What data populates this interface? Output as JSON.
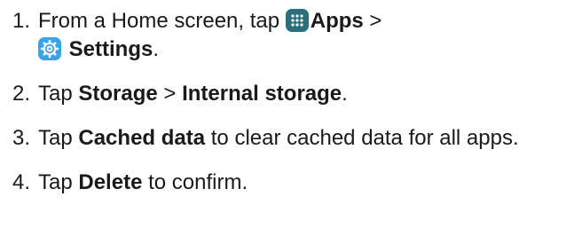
{
  "steps": [
    {
      "number": "1.",
      "t1": "From a Home screen, tap ",
      "icon1": "apps-grid-icon",
      "b1": "Apps",
      "t2": " > ",
      "icon2": "settings-gear-icon",
      "b2": "Settings",
      "t3": "."
    },
    {
      "number": "2.",
      "t1": "Tap ",
      "b1": "Storage",
      "t2": " > ",
      "b2": "Internal storage",
      "t3": "."
    },
    {
      "number": "3.",
      "t1": "Tap ",
      "b1": "Cached data",
      "t2": " to clear cached data for all apps."
    },
    {
      "number": "4.",
      "t1": "Tap ",
      "b1": "Delete",
      "t2": " to confirm."
    }
  ],
  "colors": {
    "apps_icon_bg": "#2b6f7d",
    "settings_icon_bg": "#3aa4e8",
    "text": "#1a1a1a"
  }
}
